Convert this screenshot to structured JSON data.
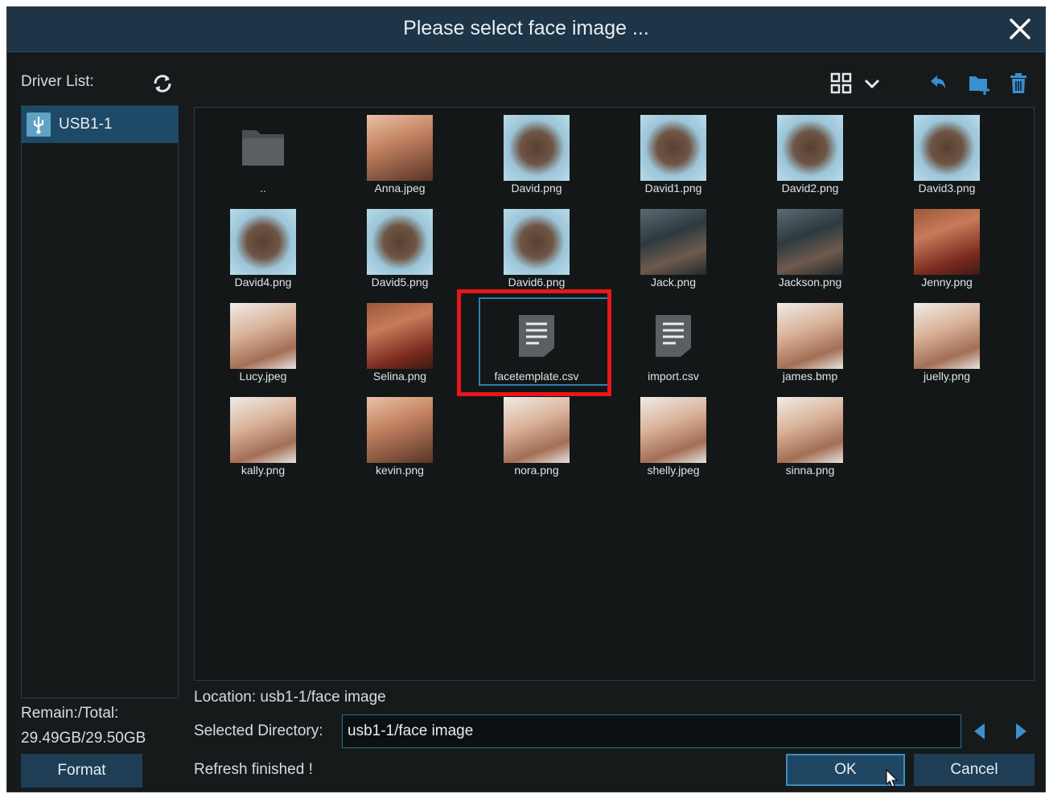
{
  "dialog": {
    "title": "Please select face image ...",
    "close_icon": "close-icon"
  },
  "sidebar": {
    "driver_label": "Driver List:",
    "refresh_icon": "refresh-icon",
    "drives": [
      {
        "label": "USB1-1",
        "icon": "usb-icon"
      }
    ],
    "remain_label": "Remain:/Total:",
    "remain_value": "29.49GB/29.50GB",
    "format_label": "Format"
  },
  "toolbar": {
    "icons": [
      "grid-view-icon",
      "chevron-down-icon",
      "back-icon",
      "new-folder-icon",
      "trash-icon"
    ]
  },
  "files": [
    {
      "name": "..",
      "kind": "folder"
    },
    {
      "name": "Anna.jpeg",
      "kind": "image"
    },
    {
      "name": "David.png",
      "kind": "image"
    },
    {
      "name": "David1.png",
      "kind": "image"
    },
    {
      "name": "David2.png",
      "kind": "image"
    },
    {
      "name": "David3.png",
      "kind": "image"
    },
    {
      "name": "David4.png",
      "kind": "image"
    },
    {
      "name": "David5.png",
      "kind": "image"
    },
    {
      "name": "David6.png",
      "kind": "image"
    },
    {
      "name": "Jack.png",
      "kind": "image"
    },
    {
      "name": "Jackson.png",
      "kind": "image"
    },
    {
      "name": "Jenny.png",
      "kind": "image"
    },
    {
      "name": "Lucy.jpeg",
      "kind": "image"
    },
    {
      "name": "Selina.png",
      "kind": "image"
    },
    {
      "name": "facetemplate.csv",
      "kind": "document",
      "selected": true
    },
    {
      "name": "import.csv",
      "kind": "document"
    },
    {
      "name": "james.bmp",
      "kind": "image"
    },
    {
      "name": "juelly.png",
      "kind": "image"
    },
    {
      "name": "kally.png",
      "kind": "image"
    },
    {
      "name": "kevin.png",
      "kind": "image"
    },
    {
      "name": "nora.png",
      "kind": "image"
    },
    {
      "name": "shelly.jpeg",
      "kind": "image"
    },
    {
      "name": "sinna.png",
      "kind": "image"
    }
  ],
  "footer": {
    "location": "Location: usb1-1/face image",
    "selected_dir_label": "Selected Directory:",
    "selected_dir_value": "usb1-1/face image",
    "status": "Refresh finished !",
    "ok_label": "OK",
    "cancel_label": "Cancel"
  },
  "colors": {
    "titlebar": "#1d3546",
    "background": "#161a1a",
    "selected_drive": "#1f4a67",
    "highlight": "#e8161b",
    "selection_border": "#2f7fb5"
  }
}
